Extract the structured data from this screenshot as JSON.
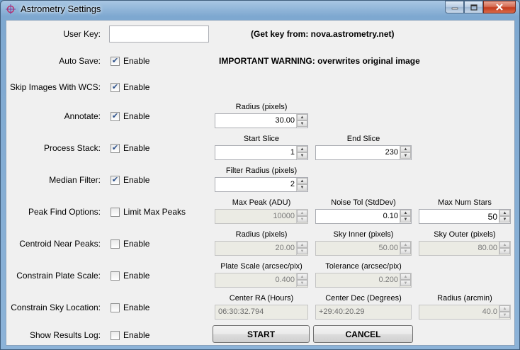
{
  "window": {
    "title": "Astrometry Settings"
  },
  "user_key": {
    "label": "User Key:",
    "value": "",
    "hint": "(Get key from: nova.astrometry.net)"
  },
  "auto_save": {
    "label": "Auto Save:",
    "checkbox": "Enable",
    "checked": true,
    "warning": "IMPORTANT WARNING: overwrites original image"
  },
  "skip_wcs": {
    "label": "Skip Images With WCS:",
    "checkbox": "Enable",
    "checked": true
  },
  "annotate": {
    "label": "Annotate:",
    "checkbox": "Enable",
    "checked": true,
    "radius": {
      "caption": "Radius (pixels)",
      "value": "30.00"
    }
  },
  "process_stack": {
    "label": "Process Stack:",
    "checkbox": "Enable",
    "checked": true,
    "start": {
      "caption": "Start Slice",
      "value": "1"
    },
    "end": {
      "caption": "End Slice",
      "value": "230"
    }
  },
  "median_filter": {
    "label": "Median Filter:",
    "checkbox": "Enable",
    "checked": true,
    "radius": {
      "caption": "Filter Radius (pixels)",
      "value": "2"
    }
  },
  "peak_find": {
    "label": "Peak Find Options:",
    "checkbox": "Limit Max Peaks",
    "checked": false,
    "max_peak": {
      "caption": "Max Peak (ADU)",
      "value": "10000"
    },
    "noise_tol": {
      "caption": "Noise Tol (StdDev)",
      "value": "0.10"
    },
    "max_stars": {
      "caption": "Max Num Stars",
      "value": "50"
    }
  },
  "centroid": {
    "label": "Centroid Near Peaks:",
    "checkbox": "Enable",
    "checked": false,
    "radius": {
      "caption": "Radius (pixels)",
      "value": "20.00"
    },
    "sky_inner": {
      "caption": "Sky Inner (pixels)",
      "value": "50.00"
    },
    "sky_outer": {
      "caption": "Sky Outer (pixels)",
      "value": "80.00"
    }
  },
  "plate_scale": {
    "label": "Constrain Plate Scale:",
    "checkbox": "Enable",
    "checked": false,
    "scale": {
      "caption": "Plate Scale (arcsec/pix)",
      "value": "0.400"
    },
    "tolerance": {
      "caption": "Tolerance (arcsec/pix)",
      "value": "0.200"
    }
  },
  "sky_location": {
    "label": "Constrain Sky Location:",
    "checkbox": "Enable",
    "checked": false,
    "ra": {
      "caption": "Center RA (Hours)",
      "value": "06:30:32.794"
    },
    "dec": {
      "caption": "Center Dec (Degrees)",
      "value": "+29:40:20.29"
    },
    "radius": {
      "caption": "Radius (arcmin)",
      "value": "40.0"
    }
  },
  "results_log": {
    "label": "Show Results Log:",
    "checkbox": "Enable",
    "checked": false
  },
  "buttons": {
    "start": "START",
    "cancel": "CANCEL"
  },
  "icons": {
    "app": "crosshair-icon",
    "check": "✔"
  }
}
